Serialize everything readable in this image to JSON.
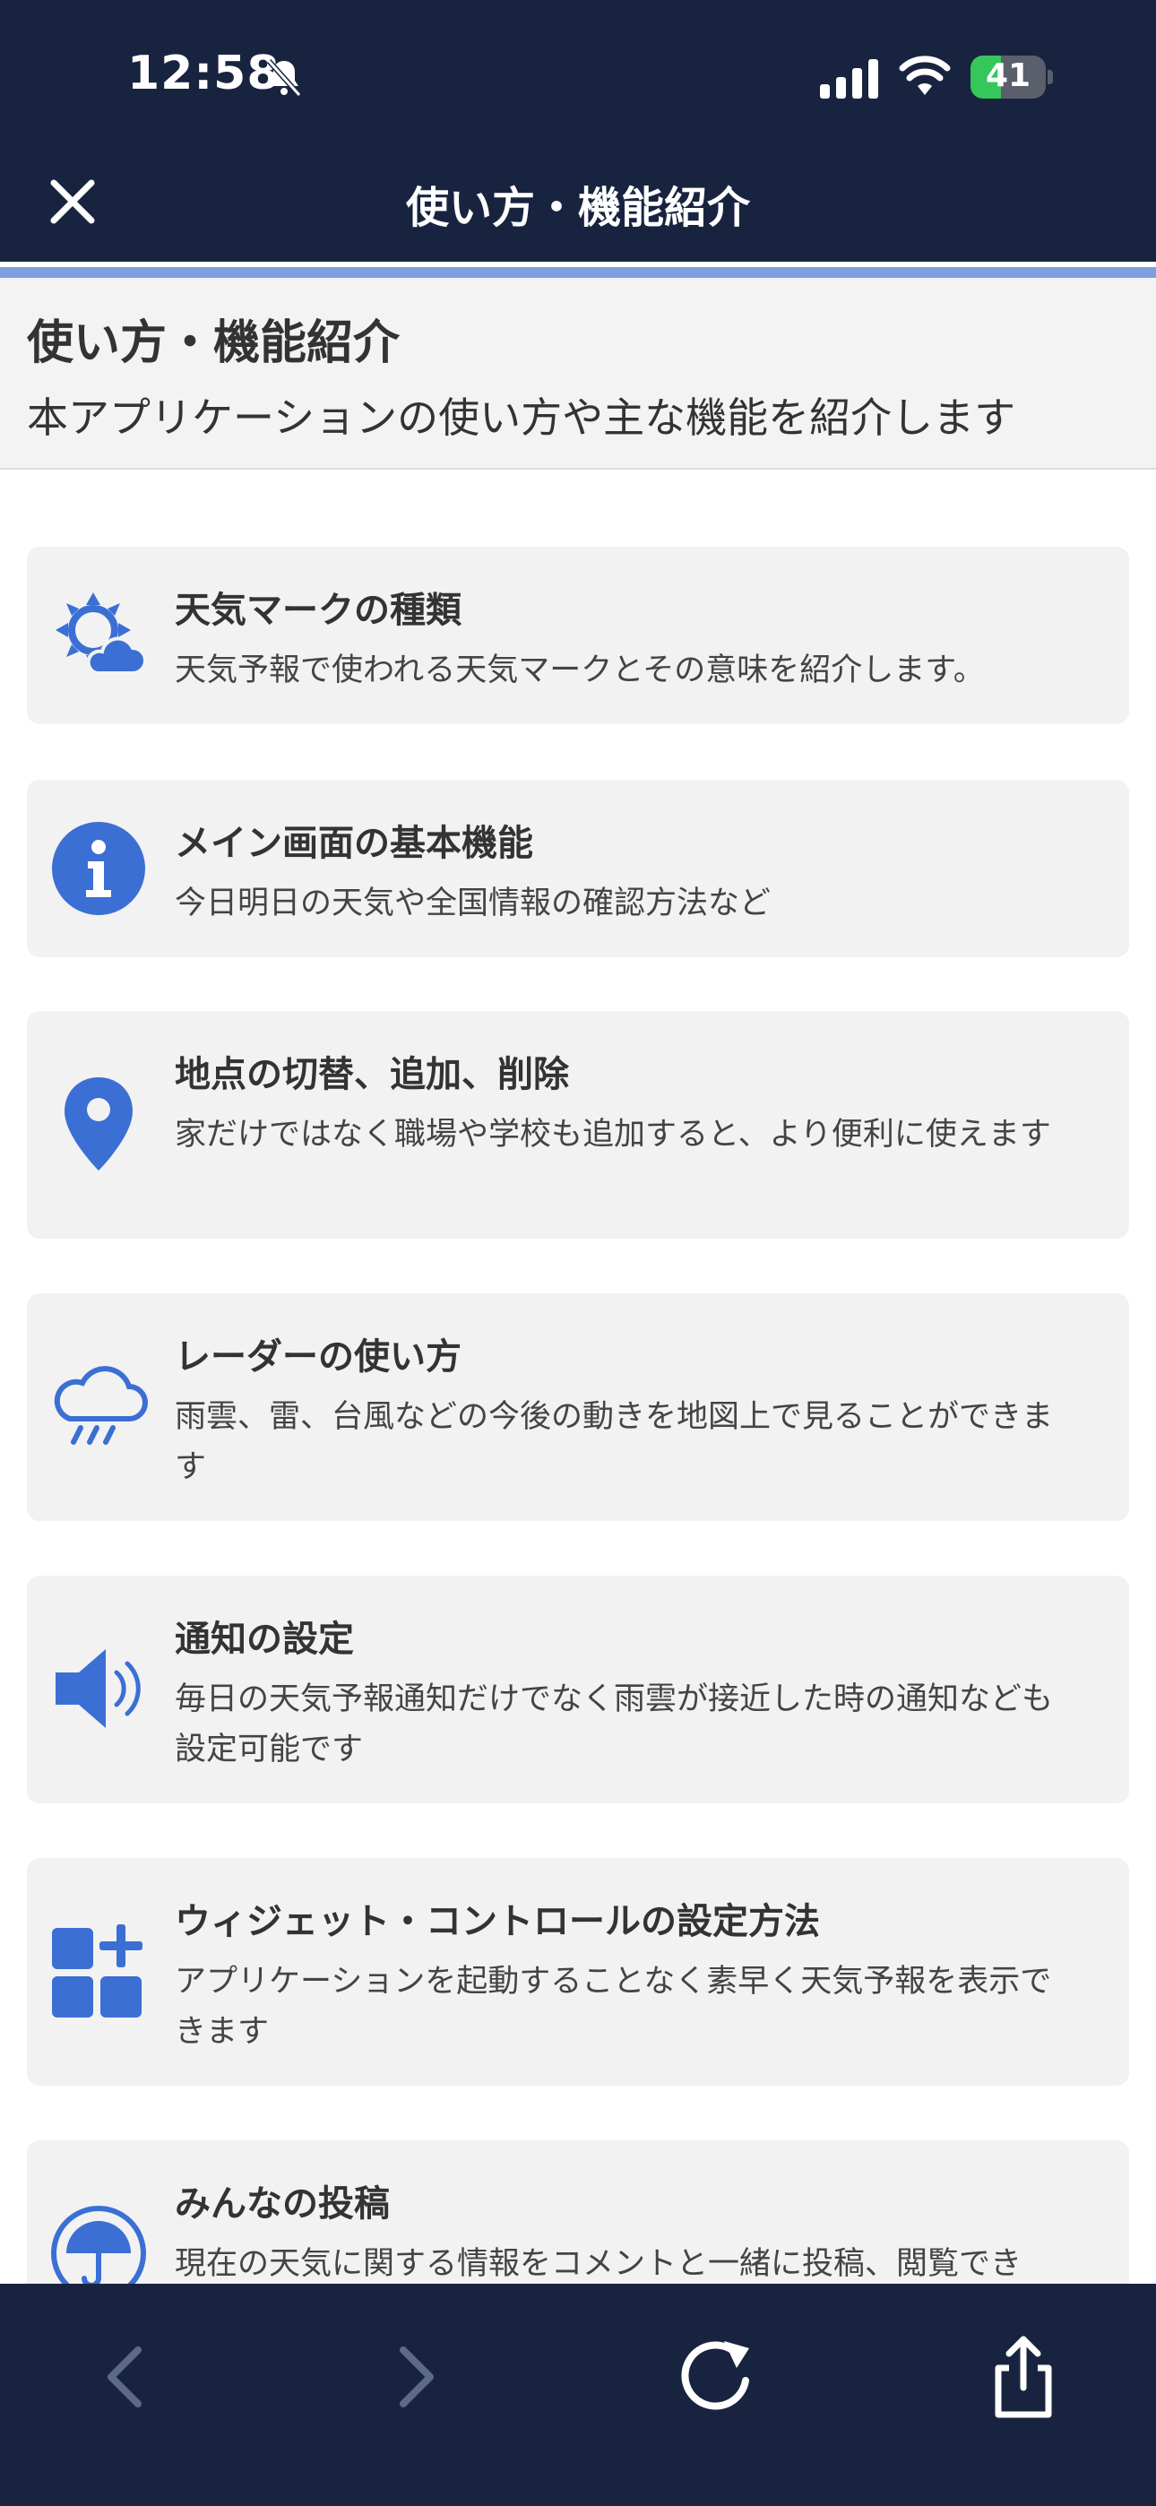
{
  "status_bar": {
    "time": "12:58",
    "battery": "41",
    "battery_level": 0.41
  },
  "header": {
    "title": "使い方・機能紹介"
  },
  "intro": {
    "title": "使い方・機能紹介",
    "subtitle": "本アプリケーションの使い方や主な機能を紹介します"
  },
  "cards": [
    {
      "icon": "sun-cloud-icon",
      "title": "天気マークの種類",
      "description": "天気予報で使われる天気マークとその意味を紹介します。"
    },
    {
      "icon": "info-icon",
      "title": "メイン画面の基本機能",
      "description": "今日明日の天気や全国情報の確認方法など"
    },
    {
      "icon": "location-pin-icon",
      "title": "地点の切替、追加、削除",
      "description": "家だけではなく職場や学校も追加すると、より便利に使えます"
    },
    {
      "icon": "rain-cloud-icon",
      "title": "レーダーの使い方",
      "description": "雨雲、雷、台風などの今後の動きを地図上で見ることができます"
    },
    {
      "icon": "speaker-icon",
      "title": "通知の設定",
      "description": "毎日の天気予報通知だけでなく雨雲が接近した時の通知なども設定可能です"
    },
    {
      "icon": "widget-add-icon",
      "title": "ウィジェット・コントロールの設定方法",
      "description": "アプリケーションを起動することなく素早く天気予報を表示できます"
    },
    {
      "icon": "umbrella-icon",
      "title": "みんなの投稿",
      "description": "現在の天気に関する情報をコメントと一緒に投稿、閲覧でき"
    }
  ],
  "colors": {
    "navy": "#18243f",
    "accent_blue": "#3b6fd4",
    "card_bg": "#f2f2f2",
    "stripe": "#7d9ee0"
  },
  "toolbar": {
    "icons": [
      "back-icon",
      "forward-icon",
      "reload-icon",
      "share-icon"
    ]
  }
}
